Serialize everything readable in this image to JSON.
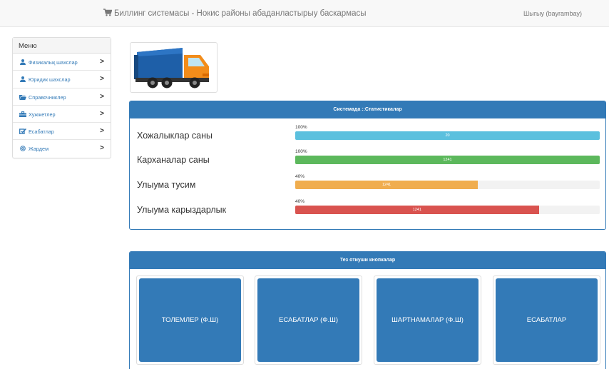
{
  "header": {
    "title": "Биллинг системасы - Нокис районы абаданластырыу баскармасы",
    "logout_label": "Шыгыу (bayrambay)"
  },
  "sidebar": {
    "title": "Меню",
    "items": [
      {
        "label": "Физикалық шахслар",
        "icon": "user-icon"
      },
      {
        "label": "Юридик шахслар",
        "icon": "user-icon"
      },
      {
        "label": "Справочниклер",
        "icon": "folder-open-icon"
      },
      {
        "label": "Хужжетлер",
        "icon": "briefcase-icon"
      },
      {
        "label": "Есабатлар",
        "icon": "edit-icon"
      },
      {
        "label": "Жардем",
        "icon": "support-icon"
      }
    ]
  },
  "logo": {
    "icon": "garbage-truck-icon"
  },
  "stats": {
    "title": "Системада ::Статистикалар",
    "rows": [
      {
        "label": "Хожалыклар саны",
        "percent_label": "100%",
        "fill": 1.0,
        "value": "20",
        "color": "#5bc0de"
      },
      {
        "label": "Карханалар саны",
        "percent_label": "100%",
        "fill": 1.0,
        "value": "1241",
        "color": "#5cb85c"
      },
      {
        "label": "Улыума тусим",
        "percent_label": "40%",
        "fill": 0.6,
        "value": "1241",
        "color": "#f0ad4e"
      },
      {
        "label": "Улыума карыздарлык",
        "percent_label": "40%",
        "fill": 0.8,
        "value": "1241",
        "color": "#d9534f"
      }
    ]
  },
  "quick": {
    "title": "Тез отиуши кнопкалар",
    "buttons": [
      {
        "label": "ТОЛЕМЛЕР (Ф.Ш)"
      },
      {
        "label": "ЕСАБАТЛАР (Ф.Ш)"
      },
      {
        "label": "ШАРТНАМАЛАР (Ф.Ш)"
      },
      {
        "label": "ЕСАБАТЛАР"
      }
    ]
  },
  "colors": {
    "primary": "#337ab7",
    "info": "#5bc0de",
    "success": "#5cb85c",
    "warning": "#f0ad4e",
    "danger": "#d9534f"
  }
}
